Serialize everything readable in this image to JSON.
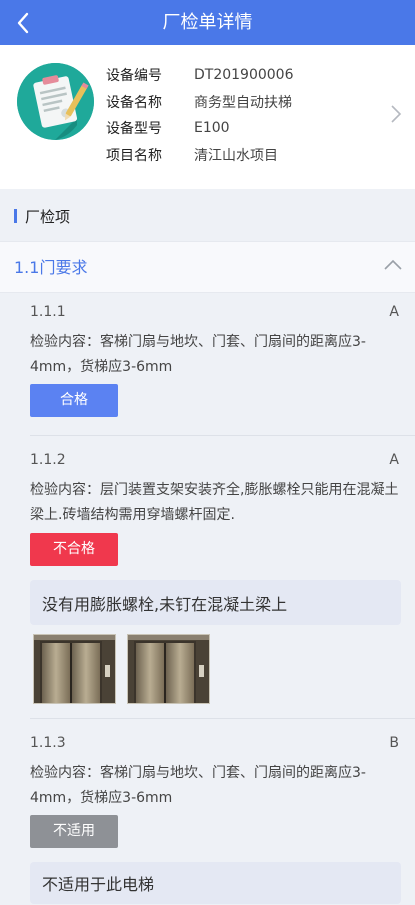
{
  "header": {
    "title": "厂检单详情",
    "back_icon": "back-arrow-icon"
  },
  "device": {
    "icon": "document-checklist-icon",
    "fields": [
      {
        "label": "设备编号",
        "value": "DT201900006"
      },
      {
        "label": "设备名称",
        "value": "商务型自动扶梯"
      },
      {
        "label": "设备型号",
        "value": "E100"
      },
      {
        "label": "项目名称",
        "value": "清江山水项目"
      }
    ]
  },
  "section": {
    "title": "厂检项"
  },
  "group": {
    "title": "1.1门要求",
    "expanded": true
  },
  "items": [
    {
      "no": "1.1.1",
      "level": "A",
      "content": "检验内容：客梯门扇与地坎、门套、门扇间的距离应3-4mm，货梯应3-6mm",
      "result": "合格"
    },
    {
      "no": "1.1.2",
      "level": "A",
      "content": "检验内容：层门装置支架安装齐全,膨胀螺栓只能用在混凝土梁上.砖墙结构需用穿墙螺杆固定.",
      "result": "不合格",
      "remark": "没有用膨胀螺栓,未钉在混凝土梁上",
      "photos": [
        "elevator-door-photo",
        "elevator-door-photo"
      ]
    },
    {
      "no": "1.1.3",
      "level": "B",
      "content": "检验内容：客梯门扇与地坎、门套、门扇间的距离应3-4mm，货梯应3-6mm",
      "result": "不适用",
      "remark": "不适用于此电梯"
    }
  ],
  "colors": {
    "primary": "#4a78e8",
    "pass": "#5b82f2",
    "fail": "#f0384d",
    "na": "#8e9196"
  }
}
